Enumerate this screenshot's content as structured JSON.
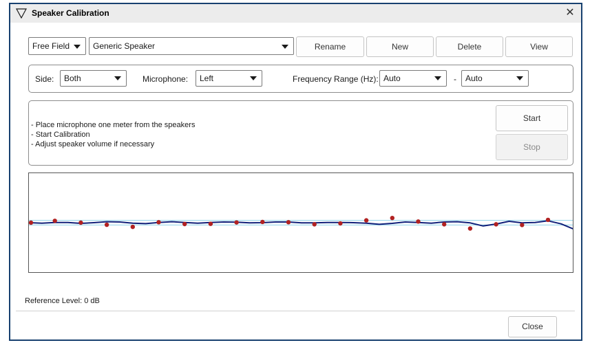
{
  "window": {
    "title": "Speaker Calibration",
    "close_glyph": "✕",
    "title_icon": "triangle-down-icon"
  },
  "speaker_row": {
    "field_type": "Free Field",
    "speaker_name": "Generic Speaker",
    "rename_label": "Rename",
    "new_label": "New",
    "delete_label": "Delete",
    "view_label": "View"
  },
  "settings": {
    "side_label": "Side:",
    "side_value": "Both",
    "microphone_label": "Microphone:",
    "microphone_value": "Left",
    "freq_label": "Frequency Range (Hz):",
    "freq_min": "Auto",
    "freq_sep": "-",
    "freq_max": "Auto"
  },
  "instructions": {
    "lines": [
      "- Place microphone one meter from the speakers",
      "- Start Calibration",
      "- Adjust speaker volume if necessary"
    ],
    "start_label": "Start",
    "stop_label": "Stop",
    "stop_enabled": false
  },
  "chart_data": {
    "type": "scatter",
    "title": "",
    "xlabel": "",
    "ylabel": "",
    "grid": false,
    "ylim": [
      -15,
      15
    ],
    "reference_band": [
      -1,
      1
    ],
    "points": {
      "color": "#b22222",
      "x": [
        0,
        1,
        2,
        3,
        4,
        5,
        6,
        7,
        8,
        9,
        10,
        11,
        12,
        13,
        14,
        15,
        16,
        17,
        18,
        19,
        20
      ],
      "y": [
        0.0,
        0.8,
        0.0,
        -0.9,
        -1.8,
        0.2,
        -0.6,
        -0.5,
        0.1,
        0.3,
        0.2,
        -0.7,
        -0.3,
        1.0,
        2.0,
        0.5,
        -0.7,
        -2.5,
        -0.7,
        -1.0,
        1.2
      ]
    },
    "fit_curve": {
      "color": "#10207a",
      "x": [
        0,
        0.5,
        1,
        1.5,
        2,
        2.5,
        3,
        3.5,
        4,
        4.5,
        5,
        5.5,
        6,
        6.5,
        7,
        7.5,
        8,
        8.5,
        9,
        9.5,
        10,
        10.5,
        11,
        11.5,
        12,
        12.5,
        13,
        13.5,
        14,
        14.5,
        15,
        15.5,
        16,
        16.5,
        17,
        17.5,
        18,
        18.5,
        19,
        19.5,
        20,
        20.5,
        21
      ],
      "y": [
        0.0,
        -0.2,
        0.1,
        0.1,
        -0.3,
        0.0,
        0.4,
        0.3,
        -0.2,
        -0.4,
        0.1,
        0.4,
        0.1,
        -0.2,
        0.1,
        0.3,
        0.2,
        -0.1,
        0.0,
        0.3,
        0.3,
        -0.1,
        -0.1,
        0.1,
        0.1,
        0.0,
        -0.2,
        -0.7,
        -0.3,
        0.3,
        0.1,
        -0.2,
        0.3,
        0.4,
        -0.1,
        -1.4,
        -0.6,
        0.6,
        -0.1,
        0.1,
        0.8,
        -0.5,
        -2.8
      ]
    }
  },
  "reference": {
    "text": "Reference Level: 0 dB"
  },
  "footer": {
    "close_label": "Close"
  }
}
